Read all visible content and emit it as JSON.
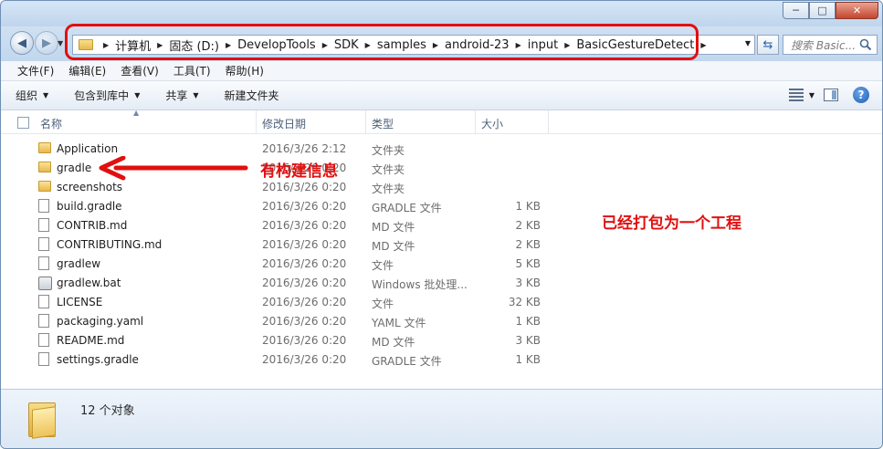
{
  "window": {
    "buttons": {
      "minimize": "─",
      "maximize": "□",
      "close": "✕"
    }
  },
  "address_bar": {
    "crumbs": [
      "计算机",
      "固态 (D:)",
      "DevelopTools",
      "SDK",
      "samples",
      "android-23",
      "input",
      "BasicGestureDetect"
    ]
  },
  "search": {
    "placeholder": "搜索 Basic..."
  },
  "menu": [
    "文件(F)",
    "编辑(E)",
    "查看(V)",
    "工具(T)",
    "帮助(H)"
  ],
  "toolbar": {
    "organize": "组织",
    "include": "包含到库中",
    "share": "共享",
    "new_folder": "新建文件夹"
  },
  "columns": {
    "name": "名称",
    "date": "修改日期",
    "type": "类型",
    "size": "大小"
  },
  "files": [
    {
      "name": "Application",
      "date": "2016/3/26 2:12",
      "type": "文件夹",
      "size": "",
      "icon": "folder"
    },
    {
      "name": "gradle",
      "date": "2016/3/26 0:20",
      "type": "文件夹",
      "size": "",
      "icon": "folder"
    },
    {
      "name": "screenshots",
      "date": "2016/3/26 0:20",
      "type": "文件夹",
      "size": "",
      "icon": "folder"
    },
    {
      "name": "build.gradle",
      "date": "2016/3/26 0:20",
      "type": "GRADLE 文件",
      "size": "1 KB",
      "icon": "file"
    },
    {
      "name": "CONTRIB.md",
      "date": "2016/3/26 0:20",
      "type": "MD 文件",
      "size": "2 KB",
      "icon": "file"
    },
    {
      "name": "CONTRIBUTING.md",
      "date": "2016/3/26 0:20",
      "type": "MD 文件",
      "size": "2 KB",
      "icon": "file"
    },
    {
      "name": "gradlew",
      "date": "2016/3/26 0:20",
      "type": "文件",
      "size": "5 KB",
      "icon": "file"
    },
    {
      "name": "gradlew.bat",
      "date": "2016/3/26 0:20",
      "type": "Windows 批处理...",
      "size": "3 KB",
      "icon": "bat"
    },
    {
      "name": "LICENSE",
      "date": "2016/3/26 0:20",
      "type": "文件",
      "size": "32 KB",
      "icon": "file"
    },
    {
      "name": "packaging.yaml",
      "date": "2016/3/26 0:20",
      "type": "YAML 文件",
      "size": "1 KB",
      "icon": "file"
    },
    {
      "name": "README.md",
      "date": "2016/3/26 0:20",
      "type": "MD 文件",
      "size": "3 KB",
      "icon": "file"
    },
    {
      "name": "settings.gradle",
      "date": "2016/3/26 0:20",
      "type": "GRADLE 文件",
      "size": "1 KB",
      "icon": "file"
    }
  ],
  "annotations": {
    "build_info": "有构建信息",
    "packaged": "已经打包为一个工程",
    "color": "#e01010"
  },
  "status": {
    "count": "12 个对象"
  }
}
